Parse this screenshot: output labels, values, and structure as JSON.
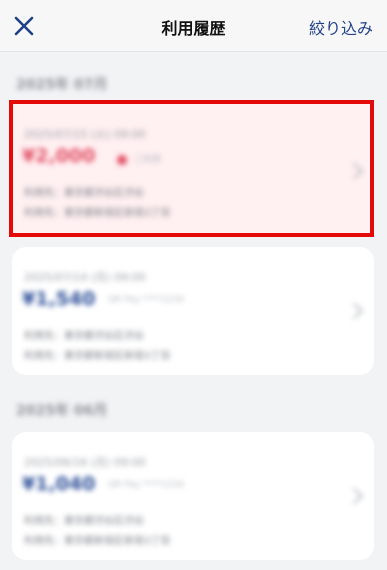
{
  "header": {
    "close_icon": "close-icon",
    "title": "利用履歴",
    "filter_label": "絞り込み"
  },
  "colors": {
    "accent": "#1f3f86",
    "highlight_bg": "#fff0f2",
    "highlight_border": "#e40a0a",
    "declined_amount": "#e24c62",
    "amount": "#2d4f98"
  },
  "sections": [
    {
      "title": "2025年 07月",
      "items": [
        {
          "date": "2025/07/15 (火) 09:00",
          "amount": "¥2,000",
          "status_icon": "alert-dot-icon",
          "method": "ご利用",
          "line1": "利用先：東京都渋谷区渋谷",
          "line2": "利用先：東京都新宿区新宿3丁目",
          "highlighted": true
        },
        {
          "date": "2025/07/14 (月) 09:00",
          "amount": "¥1,540",
          "method": "QR Pay ****1234",
          "line1": "利用先：東京都渋谷区渋谷",
          "line2": "利用先：東京都新宿区新宿3丁目",
          "highlighted": false
        }
      ]
    },
    {
      "title": "2025年 06月",
      "items": [
        {
          "date": "2025/06/16 (月) 09:00",
          "amount": "¥1,040",
          "method": "QR Pay ****1234",
          "line1": "利用先：東京都渋谷区渋谷",
          "line2": "利用先：東京都新宿区新宿3丁目",
          "highlighted": false
        }
      ]
    }
  ]
}
